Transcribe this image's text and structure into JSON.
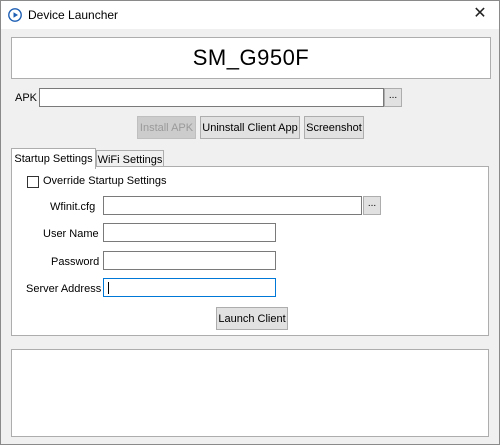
{
  "window": {
    "title": "Device Launcher",
    "close_glyph": "✕",
    "icon": "play-circle-icon"
  },
  "device": {
    "name": "SM_G950F"
  },
  "apk": {
    "label": "APK",
    "value": "",
    "browse_label": "..."
  },
  "actions": {
    "install_label": "Install APK",
    "install_enabled": false,
    "uninstall_label": "Uninstall Client App",
    "screenshot_label": "Screenshot"
  },
  "tabs": [
    {
      "label": "Startup Settings",
      "active": true
    },
    {
      "label": "WiFi Settings",
      "active": false
    }
  ],
  "startup": {
    "override_label": "Override Startup Settings",
    "override_checked": false,
    "wfinit_label": "Wfinit.cfg",
    "wfinit_value": "",
    "wfinit_browse": "...",
    "username_label": "User Name",
    "username_value": "",
    "password_label": "Password",
    "password_value": "",
    "server_label": "Server Address",
    "server_value": "",
    "launch_label": "Launch Client"
  },
  "log": {
    "text": ""
  },
  "colors": {
    "accent": "#0078d7",
    "background": "#f0f0f0",
    "button": "#e1e1e1",
    "border": "#adadad"
  }
}
